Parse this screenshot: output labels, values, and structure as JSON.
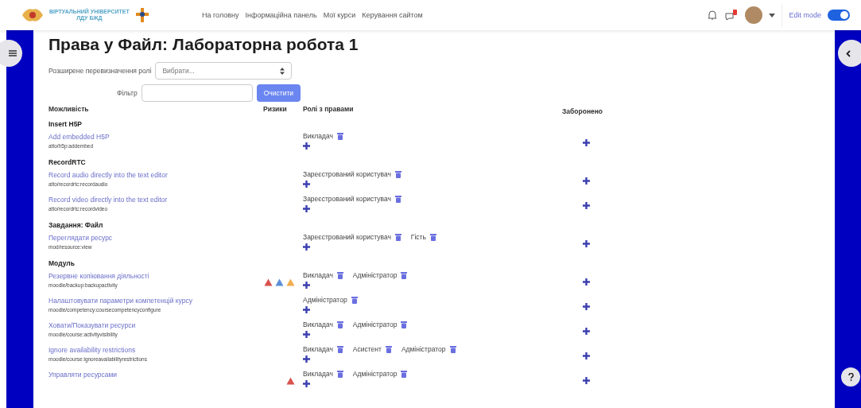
{
  "header": {
    "logo_lines": [
      "ВІРТУАЛЬНИЙ УНІВЕРСИТЕТ",
      "ЛДУ БЖД"
    ],
    "nav": [
      "На головну",
      "Інформаційна панель",
      "Мої курси",
      "Керування сайтом"
    ],
    "edit_mode": {
      "label": "Edit mode",
      "on": true
    }
  },
  "title": "Права у Файл: Лабораторна робота 1",
  "override": {
    "label": "Розширене перевизначення ролі",
    "value": "Вибрати..."
  },
  "filter": {
    "label": "Фільтр",
    "button": "Очистити"
  },
  "columns": [
    "Можливість",
    "Ризики",
    "Ролі з правами",
    "Заборонено"
  ],
  "groups": [
    {
      "name": "Insert H5P",
      "rows": [
        {
          "title": "Add embedded H5P",
          "path": "atto/h5p:addembed",
          "risks": [],
          "roles": [
            "Викладач"
          ]
        }
      ]
    },
    {
      "name": "RecordRTC",
      "rows": [
        {
          "title": "Record audio directly into the text editor",
          "path": "atto/recordrtc:recordaudio",
          "risks": [],
          "roles": [
            "Зареєстрований користувач"
          ]
        },
        {
          "title": "Record video directly into the text editor",
          "path": "atto/recordrtc:recordvideo",
          "risks": [],
          "roles": [
            "Зареєстрований користувач"
          ]
        }
      ]
    },
    {
      "name": "Завдання: Файл",
      "rows": [
        {
          "title": "Переглядати ресурс",
          "path": "mod/resource:view",
          "risks": [],
          "roles": [
            "Зареєстрований користувач",
            "Гість"
          ]
        }
      ]
    },
    {
      "name": "Модуль",
      "rows": [
        {
          "title": "Резервне копіювання діяльності",
          "path": "moodle/backup:backupactivity",
          "risks": [
            {
              "color": "#d9534f"
            },
            {
              "color": "#5b8fd6"
            },
            {
              "color": "#f0ad4e"
            }
          ],
          "roles": [
            "Викладач",
            "Адміністратор"
          ]
        },
        {
          "title": "Налаштовувати параметри компетенцій курсу",
          "path": "moodle/competency:coursecompetencyconfigure",
          "risks": [],
          "roles": [
            "Адміністратор"
          ]
        },
        {
          "title": "Ховати/Показувати ресурси",
          "path": "moodle/course:activityvisibility",
          "risks": [],
          "roles": [
            "Викладач",
            "Адміністратор"
          ]
        },
        {
          "title": "Ignore availability restrictions",
          "path": "moodle/course:ignoreavailabilityrestrictions",
          "risks": [],
          "roles": [
            "Викладач",
            "Асистент",
            "Адміністратор"
          ]
        },
        {
          "title": "Управляти ресурсами",
          "path": "",
          "risks": [
            {
              "color": "#d9534f"
            }
          ],
          "roles": [
            "Викладач",
            "Адміністратор"
          ]
        }
      ]
    }
  ]
}
